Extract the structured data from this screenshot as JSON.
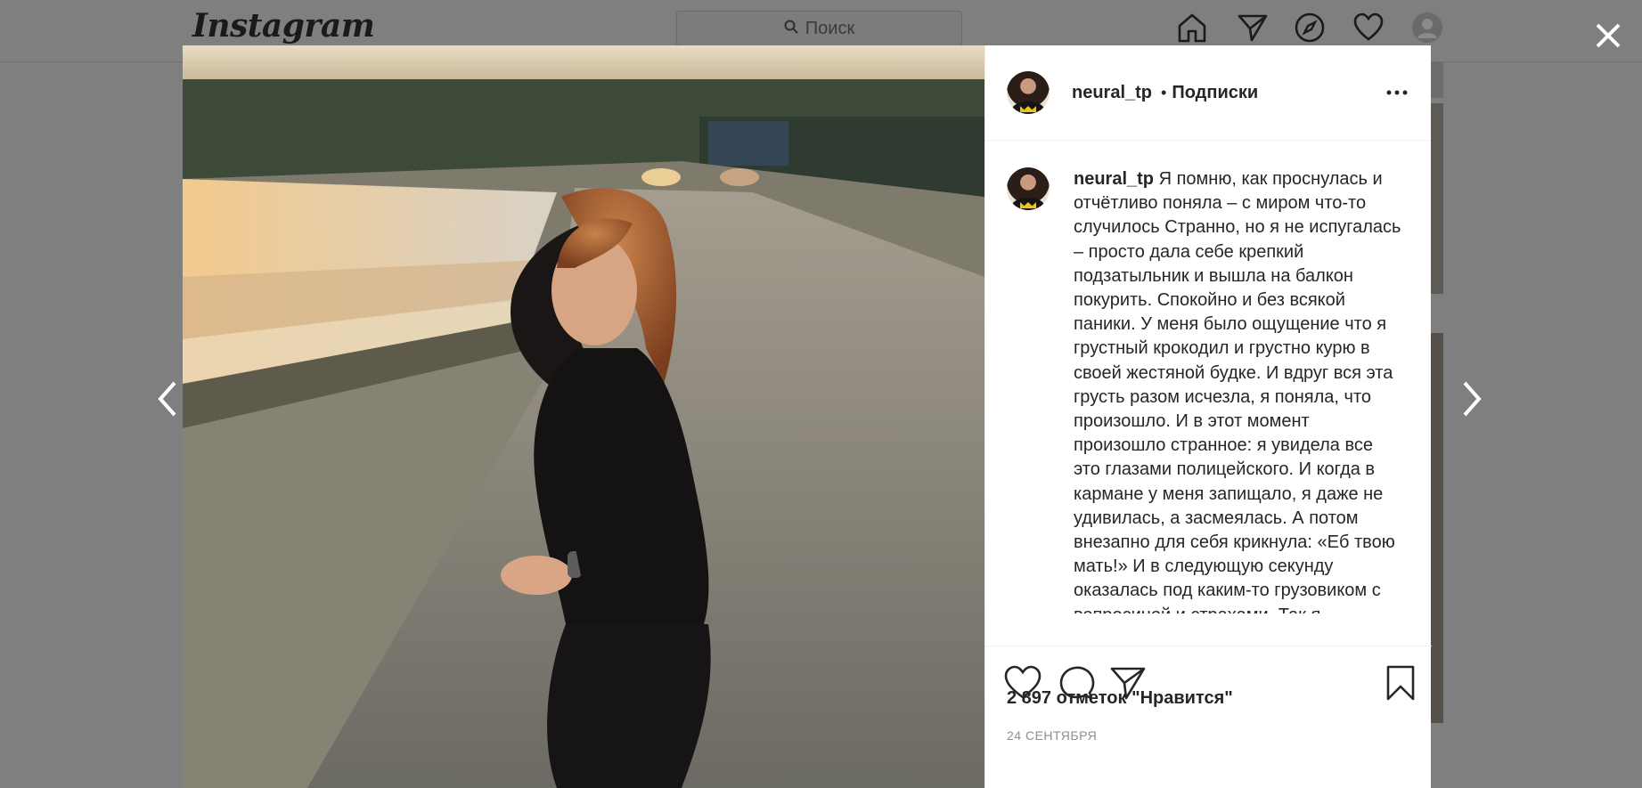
{
  "header": {
    "logo": "Instagram",
    "search_placeholder": "Поиск"
  },
  "post": {
    "username": "neural_tp",
    "dot": "•",
    "follow_label": "Подписки",
    "caption_username": "neural_tp",
    "caption": "Я помню, как проснулась и отчётливо поняла – с миром что-то случилось Странно, но я не испугалась – просто дала себе крепкий подзатыльник и вышла на балкон покурить. Спокойно и без всякой паники. У меня было ощущение что я грустный крокодил и грустно курю в своей жестяной будке. И вдруг вся эта грусть разом исчезла, я поняла, что произошло. И в этот момент произошло странное: я увидела все это глазами полицейского. И когда в кармане у меня запищало, я даже не удивилась, а засмеялась. А потом внезапно для себя крикнула: «Еб твою мать!» И в следующую секунду оказалась под каким-то грузовиком с вопросиной и страхами. Так я",
    "likes": "2 897 отметок \"Нравится\"",
    "date": "24 сентября"
  },
  "icons": {
    "nav": [
      "home-icon",
      "direct-icon",
      "explore-icon",
      "activity-heart-icon",
      "profile-avatar-icon"
    ],
    "actions": [
      "like-heart-icon",
      "comment-icon",
      "share-icon",
      "save-bookmark-icon"
    ]
  },
  "colors": {
    "overlay": "#7f7f7f",
    "text": "#262626",
    "muted": "#8e8e8e",
    "border": "#efefef"
  }
}
